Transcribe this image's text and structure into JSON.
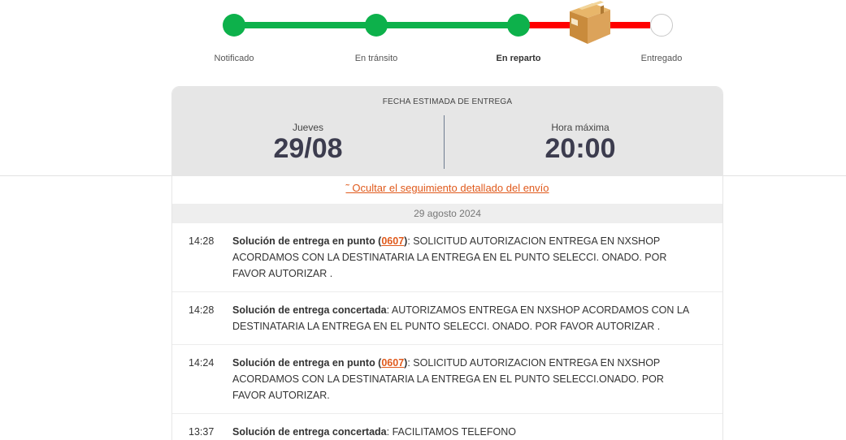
{
  "tracker": {
    "steps": [
      {
        "label": "Notificado",
        "state": "done"
      },
      {
        "label": "En tránsito",
        "state": "done"
      },
      {
        "label": "En reparto",
        "state": "current"
      },
      {
        "label": "Entregado",
        "state": "pending"
      }
    ],
    "icon": "package-box-icon"
  },
  "delivery": {
    "title": "FECHA ESTIMADA DE ENTREGA",
    "day_label": "Jueves",
    "date": "29/08",
    "time_label": "Hora máxima",
    "time": "20:00"
  },
  "toggle_label": "˜ Ocultar el seguimiento detallado del envío",
  "date_group": "29 agosto 2024",
  "events": [
    {
      "time": "14:28",
      "title": "Solución de entrega en punto",
      "code": "0607",
      "text": "SOLICITUD AUTORIZACION ENTREGA EN NXSHOP ACORDAMOS CON LA DESTINATARIA LA ENTREGA EN EL PUNTO SELECCI. ONADO. POR FAVOR AUTORIZAR ."
    },
    {
      "time": "14:28",
      "title": "Solución de entrega concertada",
      "code": "",
      "text": "AUTORIZAMOS ENTREGA EN NXSHOP ACORDAMOS CON LA DESTINATARIA LA ENTREGA EN EL PUNTO SELECCI. ONADO. POR FAVOR AUTORIZAR ."
    },
    {
      "time": "14:24",
      "title": "Solución de entrega en punto",
      "code": "0607",
      "text": "SOLICITUD AUTORIZACION ENTREGA EN NXSHOP ACORDAMOS CON LA DESTINATARIA LA ENTREGA EN EL PUNTO SELECCI.ONADO. POR FAVOR AUTORIZAR."
    },
    {
      "time": "13:37",
      "title": "Solución de entrega concertada",
      "code": "",
      "text": "FACILITAMOS TELEFONO"
    }
  ],
  "colors": {
    "done": "#0db14b",
    "remaining": "#ff0000",
    "link": "#e05a1c",
    "header_bg": "#e6e6e6"
  }
}
